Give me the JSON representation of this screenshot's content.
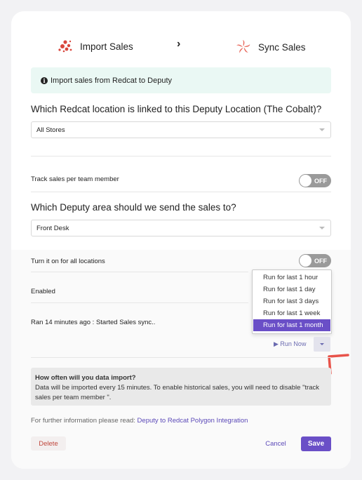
{
  "header": {
    "step1_label": "Import Sales",
    "step2_label": "Sync Sales",
    "chevron": "›",
    "step1_icon": "redcat-dots-icon",
    "step2_icon": "deputy-pinwheel-icon"
  },
  "banner": {
    "icon": "info-icon",
    "text": "Import sales from Redcat to Deputy"
  },
  "location": {
    "question": "Which Redcat location is linked to this Deputy Location (The Cobalt)?",
    "selected": "All Stores"
  },
  "track_sales": {
    "label": "Track sales per team member",
    "toggle": "OFF"
  },
  "area": {
    "question": "Which Deputy area should we send the sales to?",
    "selected": "Front Desk"
  },
  "all_locations": {
    "label": "Turn it on for all locations",
    "toggle": "OFF"
  },
  "enabled": {
    "label": "Enabled"
  },
  "status": {
    "text": "Ran 14 minutes ago : Started Sales sync.."
  },
  "run_menu": {
    "items": [
      "Run for last 1 hour",
      "Run for last 1 day",
      "Run for last 3 days",
      "Run for last 1 week",
      "Run for last 1 month"
    ],
    "selected_index": 4
  },
  "run_now": {
    "label": "▶ Run Now"
  },
  "note": {
    "title": "How often will you data import?",
    "body": "Data will be imported every 15 minutes. To enable historical sales, you will need to disable \"track sales per team member \"."
  },
  "footer": {
    "info_prefix": "For further information please read:",
    "link_text": "Deputy to Redcat Polygon Integration"
  },
  "actions": {
    "delete": "Delete",
    "cancel": "Cancel",
    "save": "Save"
  },
  "colors": {
    "accent": "#6a4fc7",
    "danger": "#c0473d",
    "banner_bg": "#eaf8f4",
    "annotation": "#e8534a"
  }
}
